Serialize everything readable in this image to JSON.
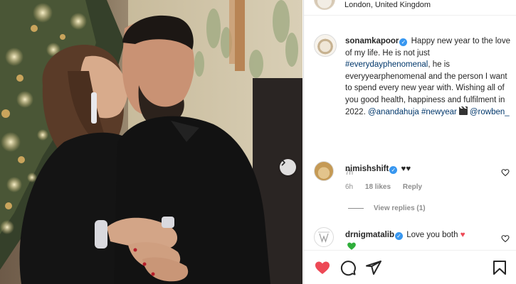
{
  "header": {
    "location": "London, United Kingdom"
  },
  "caption": {
    "username": "sonamkapoor",
    "text_1": " Happy new year to the love of my life. He is not just ",
    "hashtag_1": "#everydayphenomenal",
    "text_2": ", he is everyyearphenomenal and the person I want to spend every new year with. Wishing all of you good health, happiness and fulfilment in 2022. ",
    "mention_1": "@anandahuja",
    "hashtag_2": "#newyear",
    "mention_2": "@rowben_",
    "time": "7h"
  },
  "comments": [
    {
      "username": "nimishshift",
      "text": "♥♥",
      "time": "6h",
      "likes": "18 likes",
      "reply": "Reply"
    },
    {
      "username": "drnigmatalib",
      "text": "Love you both",
      "heart": "♥"
    }
  ],
  "view_replies": "View replies (1)",
  "icons": {
    "verified": "verified-badge",
    "next": "chevron-right-icon",
    "like": "heart-icon",
    "comment": "comment-icon",
    "share": "paper-plane-icon",
    "save": "bookmark-icon"
  },
  "colors": {
    "like_active": "#ed4956",
    "verified": "#3897f0",
    "link": "#00376b",
    "muted": "#8e8e8e"
  }
}
